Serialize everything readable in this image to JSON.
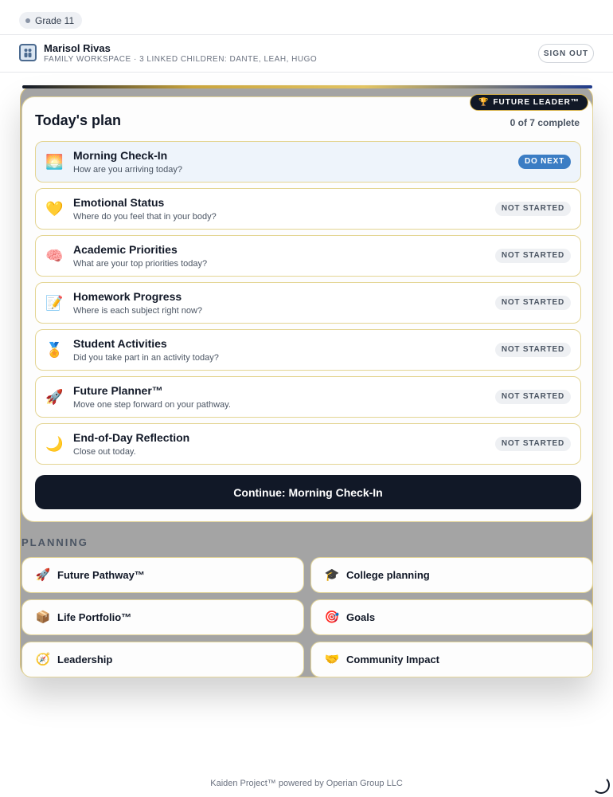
{
  "grade": "Grade 11",
  "profile": {
    "name": "Marisol Rivas",
    "subtitle": "Family workspace · 3 linked children: Dante, Leah, Hugo",
    "sign_out": "SIGN OUT"
  },
  "plan": {
    "badge": "FUTURE LEADER™",
    "badge_icon": "🏆",
    "title": "Today's plan",
    "progress": "0 of 7 complete",
    "tasks": [
      {
        "icon": "🌅",
        "title": "Morning Check-In",
        "subtitle": "How are you arriving today?",
        "status": "DO NEXT"
      },
      {
        "icon": "💛",
        "title": "Emotional Status",
        "subtitle": "Where do you feel that in your body?",
        "status": "NOT STARTED"
      },
      {
        "icon": "🧠",
        "title": "Academic Priorities",
        "subtitle": "What are your top priorities today?",
        "status": "NOT STARTED"
      },
      {
        "icon": "📝",
        "title": "Homework Progress",
        "subtitle": "Where is each subject right now?",
        "status": "NOT STARTED"
      },
      {
        "icon": "🏅",
        "title": "Student Activities",
        "subtitle": "Did you take part in an activity today?",
        "status": "NOT STARTED"
      },
      {
        "icon": "🚀",
        "title": "Future Planner™",
        "subtitle": "Move one step forward on your pathway.",
        "status": "NOT STARTED"
      },
      {
        "icon": "🌙",
        "title": "End-of-Day Reflection",
        "subtitle": "Close out today.",
        "status": "NOT STARTED"
      }
    ],
    "continue_label": "Continue: Morning Check-In"
  },
  "planning": {
    "heading": "PLANNING",
    "links": [
      {
        "icon": "🚀",
        "label": "Future Pathway™"
      },
      {
        "icon": "🎓",
        "label": "College planning"
      },
      {
        "icon": "📦",
        "label": "Life Portfolio™"
      },
      {
        "icon": "🎯",
        "label": "Goals"
      },
      {
        "icon": "🧭",
        "label": "Leadership"
      },
      {
        "icon": "🤝",
        "label": "Community Impact"
      }
    ]
  },
  "footer": "Kaiden Project™ powered by Operian Group LLC",
  "colors": {
    "accent_gold": "#d6b24a",
    "do_next_blue": "#3b7dc4",
    "dark": "#111827"
  }
}
